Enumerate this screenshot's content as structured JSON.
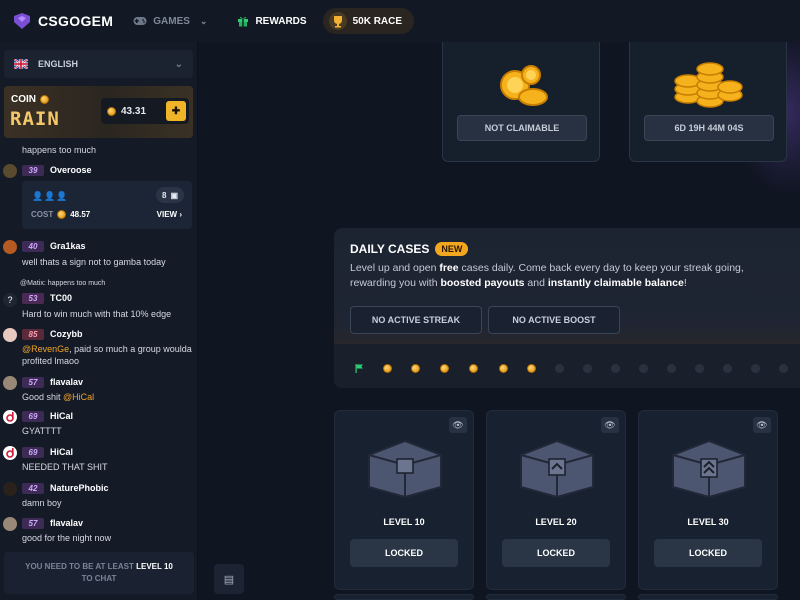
{
  "topbar": {
    "logo_main": "CSGO",
    "logo_bold": "GEM",
    "games_label": "GAMES",
    "rewards_label": "REWARDS",
    "race_label": "50K RACE"
  },
  "sidebar": {
    "language": "ENGLISH",
    "rain": {
      "coin_label": "COIN",
      "rain_label": "RAIN",
      "amount": "43.31"
    },
    "chat": [
      {
        "text": "happens too much"
      },
      {
        "level": "39",
        "name": "Overoose"
      },
      {
        "level": "40",
        "name": "Gra1kas",
        "text": "well thats a sign not to gamba today"
      },
      {
        "reply": "@Matix: happens too much",
        "level": "53",
        "name": "TC00",
        "text": "Hard to win much with that 10% edge"
      },
      {
        "level": "85",
        "name": "Cozybb",
        "mention": "@RevenGe",
        "text": ", paid so much a group woulda profited lmaoo"
      },
      {
        "level": "57",
        "name": "flavalav",
        "text": "Good shit ",
        "mention": "@HiCal"
      },
      {
        "level": "69",
        "name": "HiCal",
        "text": "GYATTTT"
      },
      {
        "level": "69",
        "name": "HiCal",
        "text": "NEEDED THAT SHIT"
      },
      {
        "level": "42",
        "name": "NaturePhobic",
        "text": "damn boy"
      },
      {
        "level": "57",
        "name": "flavalav",
        "text": "good for the night now"
      }
    ],
    "rain_box": {
      "count": "8",
      "cost_label": "COST",
      "cost": "48.57",
      "view_label": "VIEW"
    },
    "footer": {
      "prefix": "YOU NEED TO BE AT LEAST",
      "level": "LEVEL 10",
      "suffix": "TO CHAT"
    }
  },
  "main": {
    "top_cards": [
      {
        "status": "NOT CLAIMABLE"
      },
      {
        "status": "6D 19H 44M 04S"
      }
    ],
    "daily": {
      "title": "DAILY CASES",
      "badge": "NEW",
      "desc_1": "Level up and open ",
      "desc_free": "free",
      "desc_2": " cases daily. Come back every day to keep your streak going, rewarding you with ",
      "desc_boosted": "boosted payouts",
      "desc_3": " and ",
      "desc_instant": "instantly claimable balance",
      "desc_4": "!",
      "streak_button": "NO ACTIVE STREAK",
      "boost_button": "NO ACTIVE BOOST"
    },
    "cases": [
      {
        "level": "LEVEL 10",
        "action": "LOCKED"
      },
      {
        "level": "LEVEL 20",
        "action": "LOCKED"
      },
      {
        "level": "LEVEL 30",
        "action": "LOCKED"
      }
    ]
  },
  "colors": {
    "accent": "#f3a71f",
    "level_badge": "#3d2a55",
    "background": "#0f1521"
  }
}
